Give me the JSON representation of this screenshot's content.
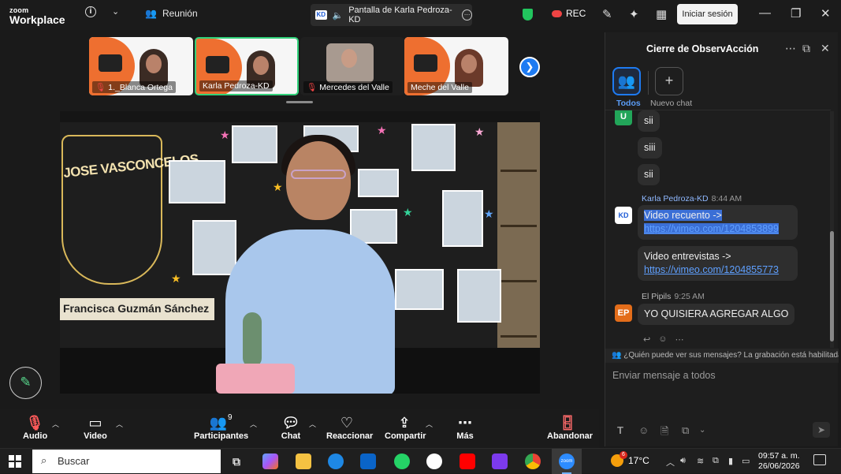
{
  "app": {
    "brand_top": "zoom",
    "brand_bottom": "Workplace"
  },
  "header": {
    "meeting_label": "Reunión",
    "share_label": "Pantalla de Karla Pedroza-KD",
    "share_logo": "KD",
    "rec_label": "REC",
    "signin_label": "Iniciar sesión"
  },
  "participants": [
    {
      "name": "1._Blanca Ortega",
      "muted": true
    },
    {
      "name": "Karla Pedroza-KD",
      "muted": false
    },
    {
      "name": "Mercedes del Valle",
      "muted": true
    },
    {
      "name": "Meche del Valle",
      "muted": false
    }
  ],
  "video": {
    "emblem_title": "JOSE VASCONCELOS",
    "nameplate": "Francisca Guzmán Sánchez"
  },
  "toolbar": {
    "audio": "Audio",
    "video": "Video",
    "participants": "Participantes",
    "participants_count": "9",
    "chat": "Chat",
    "reactions": "Reaccionar",
    "share": "Compartir",
    "more": "Más",
    "leave": "Abandonar"
  },
  "chat": {
    "title": "Cierre de ObservAcción",
    "tab_all": "Todos",
    "tab_new": "Nuevo chat",
    "user_initial": "U",
    "messages_short": [
      "sii",
      "siii",
      "sii"
    ],
    "sender1": "Karla Pedroza-KD",
    "sender1_time": "8:44 AM",
    "msg1_text": "Video recuento ->",
    "msg1_link": "https://vimeo.com/1204853899",
    "msg2_text": "Video entrevistas ->",
    "msg2_link": "https://vimeo.com/1204855773",
    "sender2_initials": "EP",
    "sender2": "El Pipils",
    "sender2_time": "9:25 AM",
    "msg3_text": "YO QUISIERA AGREGAR ALGO",
    "notice": "¿Quién puede ver sus mensajes? La grabación está habilitada",
    "input_placeholder": "Enviar mensaje a todos"
  },
  "taskbar": {
    "search_placeholder": "Buscar",
    "weather_temp": "17°C",
    "weather_badge": "6",
    "time": "09:57 a. m.",
    "date": "26/06/2026"
  },
  "colors": {
    "accent": "#1e7bf2",
    "active_speaker": "#31d17a",
    "shield": "#22c55e",
    "rec": "#ef4444"
  }
}
